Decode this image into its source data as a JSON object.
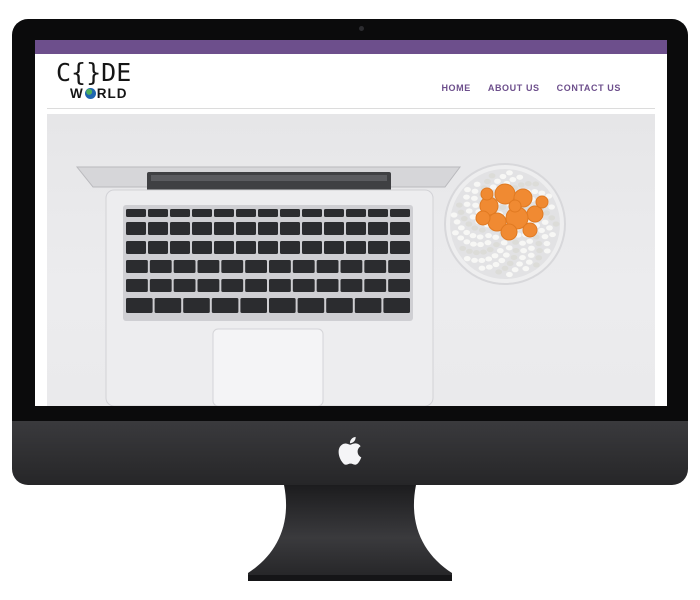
{
  "site": {
    "logo": {
      "text_line1": "C{}DE",
      "text_line2_left": "W",
      "text_line2_right": "RLD"
    },
    "nav": {
      "items": [
        "HOME",
        "ABOUT US",
        "CONTACT US"
      ]
    }
  },
  "colors": {
    "accent": "#6d4f8c",
    "bezel": "#0b0b0c",
    "chin": "#303033"
  },
  "hero": {
    "image": "laptop keyboard and orange succulent in white pebble bowl, top view"
  },
  "device": {
    "logo": "apple-icon"
  }
}
